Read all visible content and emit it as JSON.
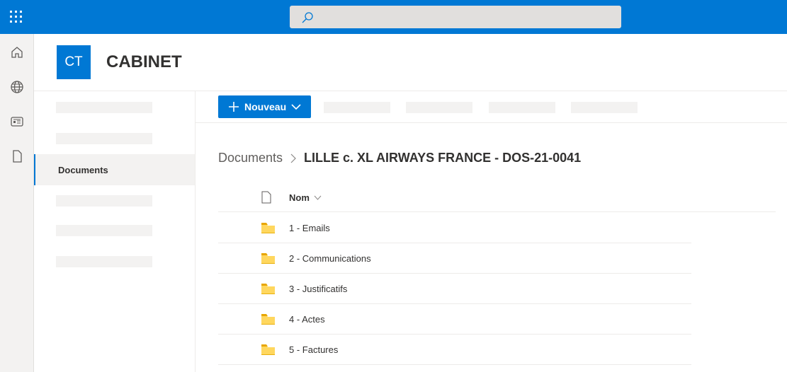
{
  "site": {
    "initials": "CT",
    "title": "CABINET"
  },
  "nav": {
    "active_item": "Documents"
  },
  "toolbar": {
    "new_label": "Nouveau"
  },
  "breadcrumb": {
    "root": "Documents",
    "current": "LILLE c. XL AIRWAYS FRANCE - DOS-21-0041"
  },
  "list": {
    "column_name": "Nom",
    "items": [
      {
        "name": "1 - Emails"
      },
      {
        "name": "2 - Communications"
      },
      {
        "name": "3 - Justificatifs"
      },
      {
        "name": "4 - Actes"
      },
      {
        "name": "5 - Factures"
      }
    ]
  },
  "colors": {
    "brand": "#0078d4",
    "folder": "#ffd75e"
  }
}
